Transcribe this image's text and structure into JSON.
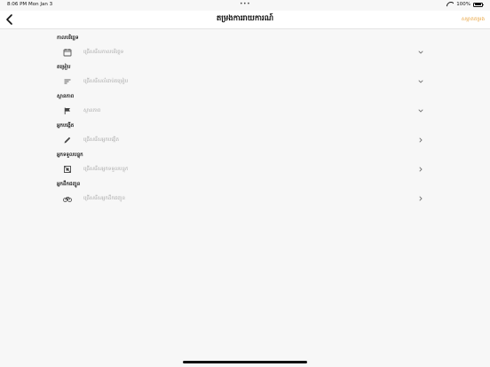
{
  "status_bar": {
    "time": "8:06 PM",
    "date": "Mon Jan 3",
    "multitask_dots": "•••",
    "battery_text": "100%",
    "battery_level": 1.0,
    "icons": [
      "wifi-icon",
      "battery-icon"
    ]
  },
  "nav": {
    "title": "តម្រងការរាយការណ៍",
    "action_label": "សម្អាតតម្រង",
    "action_color": "#e8a13a",
    "back_icon": "chevron-left-icon"
  },
  "fields": [
    {
      "label": "កាលបរិច្ឆេទ",
      "value": "ជ្រើសរើសកាលបរិច្ឆេទ",
      "icon": "calendar-icon",
      "chevron": "chevron-down-icon"
    },
    {
      "label": "តម្រៀប",
      "value": "ជ្រើសរើសលំដាប់តម្រៀប",
      "icon": "sort-lines-icon",
      "chevron": "chevron-down-icon"
    },
    {
      "label": "ស្ថានភាព",
      "value": "ស្ថានភាព",
      "icon": "flag-icon",
      "chevron": "chevron-down-icon"
    },
    {
      "label": "អ្នកបង្កើត",
      "value": "ជ្រើសរើសអ្នកបង្កើត",
      "icon": "pencil-icon",
      "chevron": "chevron-right-icon"
    },
    {
      "label": "អ្នកទទួលបន្ទុក",
      "value": "ជ្រើសរើសអ្នកទទួលបន្ទុក",
      "icon": "expand-frame-icon",
      "chevron": "chevron-right-icon"
    },
    {
      "label": "អ្នកដឹកជញ្ជូន",
      "value": "ជ្រើសរើសអ្នកដឹកជញ្ជូន",
      "icon": "bicycle-icon",
      "chevron": "chevron-right-icon"
    }
  ]
}
